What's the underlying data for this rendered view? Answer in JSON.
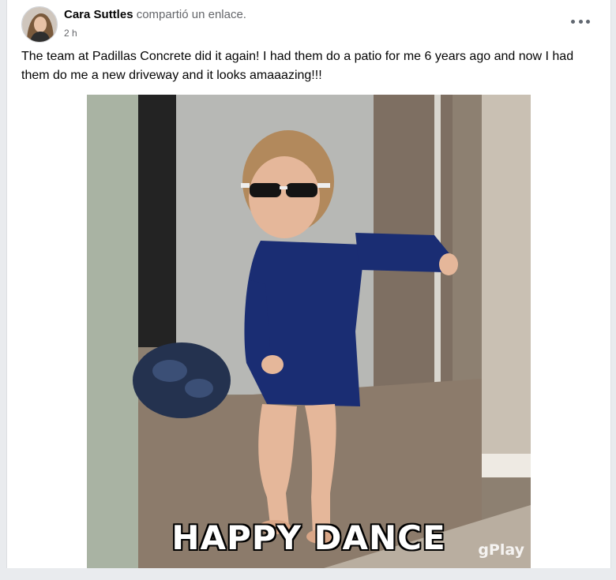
{
  "post": {
    "author_name": "Cara Suttles",
    "action_text": "compartió un enlace.",
    "timestamp": "2 h",
    "body_text": "The team at Padillas Concrete did it again! I had them do a patio for me 6 years ago and now I had them do me a new driveway and it looks amaaazing!!!",
    "more_icon": "more-horizontal-icon"
  },
  "media": {
    "caption": "HAPPY DANCE",
    "watermark": "gPlay",
    "type": "animated gif"
  }
}
